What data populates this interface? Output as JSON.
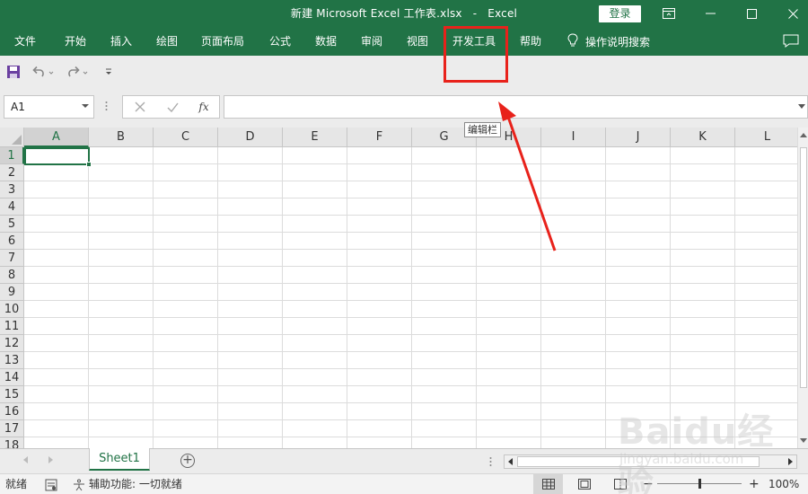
{
  "window": {
    "title_file": "新建 Microsoft Excel 工作表.xlsx",
    "title_sep": "-",
    "title_app": "Excel",
    "login_label": "登录"
  },
  "ribbon": {
    "tabs": [
      {
        "label": "文件"
      },
      {
        "label": "开始"
      },
      {
        "label": "插入"
      },
      {
        "label": "绘图"
      },
      {
        "label": "页面布局"
      },
      {
        "label": "公式"
      },
      {
        "label": "数据"
      },
      {
        "label": "审阅"
      },
      {
        "label": "视图"
      },
      {
        "label": "开发工具"
      },
      {
        "label": "帮助"
      }
    ],
    "tell_me": "操作说明搜索"
  },
  "formula_bar": {
    "name_box": "A1",
    "fx_label": "fx",
    "value": "",
    "tooltip": "编辑栏"
  },
  "grid": {
    "columns": [
      "A",
      "B",
      "C",
      "D",
      "E",
      "F",
      "G",
      "H",
      "I",
      "J",
      "K",
      "L"
    ],
    "rows": [
      "1",
      "2",
      "3",
      "4",
      "5",
      "6",
      "7",
      "8",
      "9",
      "10",
      "11",
      "12",
      "13",
      "14",
      "15",
      "16",
      "17",
      "18"
    ],
    "active_cell": "A1"
  },
  "sheets": {
    "tabs": [
      {
        "label": "Sheet1",
        "active": true
      }
    ],
    "add_label": "+"
  },
  "status_bar": {
    "ready": "就绪",
    "accessibility": "辅助功能: 一切就绪",
    "zoom_minus": "−",
    "zoom_plus": "+",
    "zoom_level": "100%"
  },
  "watermark": {
    "brand": "Baidu经验",
    "url": "jingyan.baidu.com"
  },
  "colors": {
    "excel_green": "#217346",
    "annotation_red": "#e8221b"
  }
}
